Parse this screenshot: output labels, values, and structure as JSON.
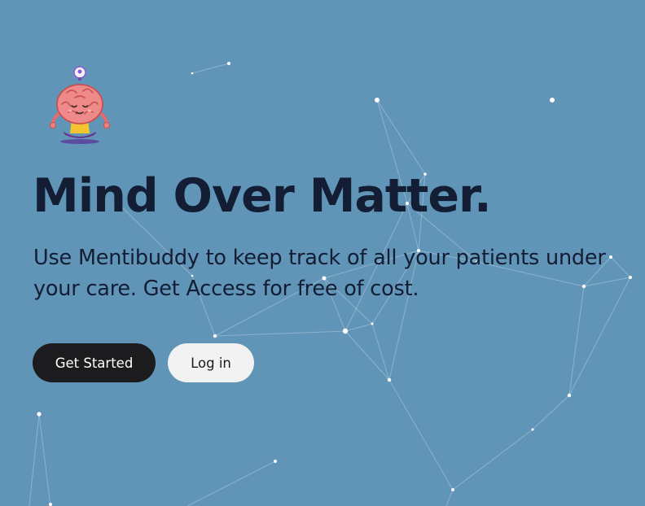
{
  "hero": {
    "title_strong": "Mind",
    "title_rest": " Over Matter.",
    "subtitle": "Use Mentibuddy to keep track of all your patients under your care. Get Access for free of cost.",
    "primary_button": "Get Started",
    "secondary_button": "Log in"
  },
  "colors": {
    "background": "#6195b8",
    "title_text": "#131d33",
    "primary_button_bg": "#1c1c1e",
    "secondary_button_bg": "#f2f2f2",
    "network_line": "#ffffff"
  },
  "icons": {
    "mascot": "meditating-brain-mascot-icon"
  }
}
